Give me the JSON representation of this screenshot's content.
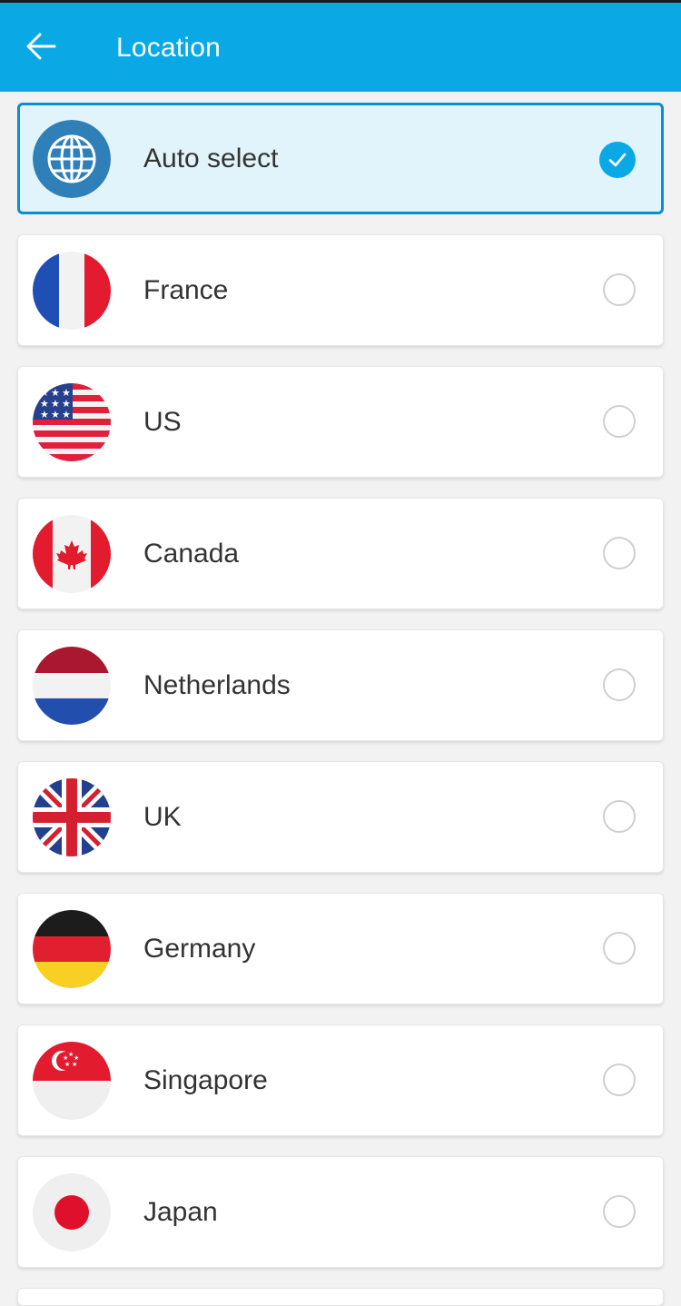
{
  "header": {
    "title": "Location",
    "back_icon": "arrow-left-icon",
    "background_color": "#0aa9e6"
  },
  "locations": [
    {
      "name": "Auto select",
      "icon": "globe-icon",
      "selected": true
    },
    {
      "name": "France",
      "icon": "flag-france-icon",
      "selected": false
    },
    {
      "name": "US",
      "icon": "flag-us-icon",
      "selected": false
    },
    {
      "name": "Canada",
      "icon": "flag-canada-icon",
      "selected": false
    },
    {
      "name": "Netherlands",
      "icon": "flag-netherlands-icon",
      "selected": false
    },
    {
      "name": "UK",
      "icon": "flag-uk-icon",
      "selected": false
    },
    {
      "name": "Germany",
      "icon": "flag-germany-icon",
      "selected": false
    },
    {
      "name": "Singapore",
      "icon": "flag-singapore-icon",
      "selected": false
    },
    {
      "name": "Japan",
      "icon": "flag-japan-icon",
      "selected": false
    }
  ],
  "colors": {
    "accent": "#0aa9e6",
    "selected_border": "#0a8fd0",
    "selected_background": "#e1f3fb"
  }
}
